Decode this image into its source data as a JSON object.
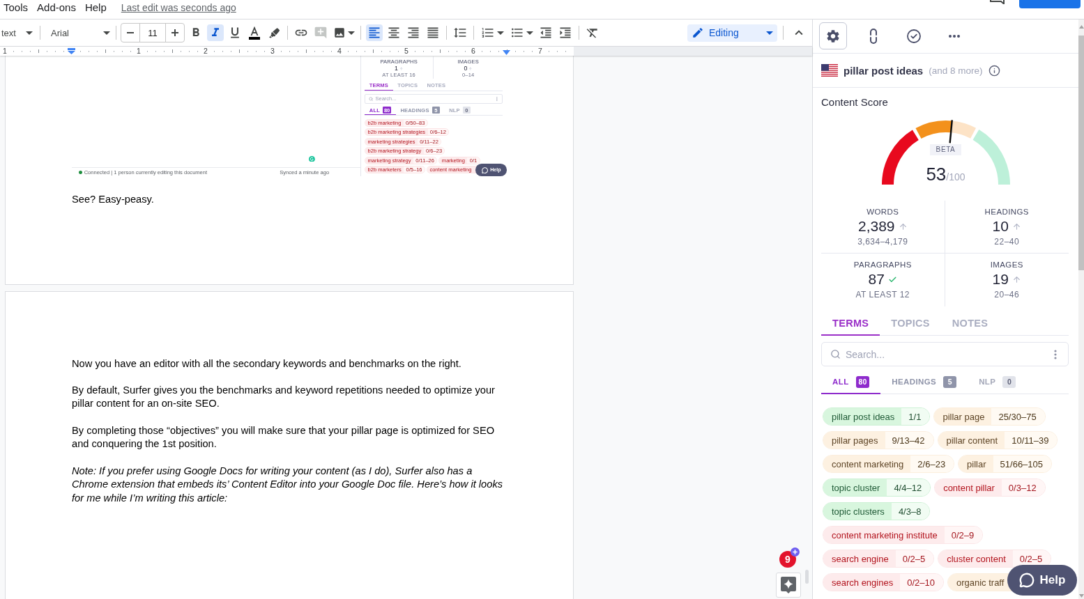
{
  "menu_bar": {
    "items": [
      "Tools",
      "Add-ons",
      "Help"
    ],
    "last_edit": "Last edit was seconds ago"
  },
  "toolbar": {
    "style": "text",
    "font": "Arial",
    "font_size": "11",
    "format": [
      {
        "kind": "bold",
        "selected": false
      },
      {
        "kind": "italic",
        "selected": true
      },
      {
        "kind": "underline",
        "selected": false
      }
    ],
    "insert": [
      {
        "kind": "link",
        "disabled": false
      },
      {
        "kind": "comment",
        "disabled": true
      },
      {
        "kind": "image",
        "disabled": false
      }
    ],
    "align": [
      {
        "kind": "left",
        "selected": true
      },
      {
        "kind": "center",
        "selected": false
      },
      {
        "kind": "right",
        "selected": false
      },
      {
        "kind": "justify",
        "selected": false
      }
    ],
    "mode": "Editing"
  },
  "ruler": {
    "labels": [
      "1",
      "1",
      "2",
      "3",
      "4",
      "5",
      "6",
      "7"
    ]
  },
  "document": {
    "pages": [
      {
        "blocks": [
          {
            "kind": "screenshot"
          },
          {
            "kind": "paragraph",
            "text": "See? Easy-peasy.",
            "italic": false
          }
        ]
      },
      {
        "blocks": [
          {
            "kind": "paragraph",
            "text": "Now you have an editor with all the secondary keywords and benchmarks on the right.",
            "italic": false
          },
          {
            "kind": "paragraph",
            "text": "By default, Surfer gives you the benchmarks and keyword repetitions needed to optimize your pillar content for an on-site SEO.",
            "italic": false
          },
          {
            "kind": "paragraph",
            "text": "By completing those “objectives” you will make sure that your pillar page is optimized for SEO and conquering the 1st position.",
            "italic": false
          },
          {
            "kind": "paragraph",
            "text": "Note: If you prefer using Google Docs for writing your content (as I do), Surfer also has a Chrome extension that embeds its’ Content Editor into your Google Doc file. Here’s how it looks for me while I’m writing this article:",
            "italic": true
          }
        ]
      }
    ]
  },
  "screenshot": {
    "footer": {
      "status": "Connected | 1 person currently editing this document",
      "sync": "Synced a minute ago"
    },
    "metrics": [
      {
        "label": "PARAGRAPHS",
        "value": "1",
        "range": "AT LEAST 16",
        "kind": "below"
      },
      {
        "label": "IMAGES",
        "value": "0",
        "range": "0–14",
        "kind": "below"
      }
    ],
    "tabs": [
      {
        "label": "TERMS",
        "selected": true
      },
      {
        "label": "TOPICS",
        "selected": false
      },
      {
        "label": "NOTES",
        "selected": false
      }
    ],
    "search": {
      "placeholder": "Search..."
    },
    "filters": [
      {
        "label": "ALL",
        "count": "80",
        "selected": true,
        "disabled": false
      },
      {
        "label": "HEADINGS",
        "count": "5",
        "selected": false,
        "disabled": false
      },
      {
        "label": "NLP",
        "count": "0",
        "selected": false,
        "disabled": true
      }
    ],
    "term_rows": [
      [
        {
          "term": "b2b marketing",
          "count": "0/50–83",
          "kind": "missing"
        }
      ],
      [
        {
          "term": "b2b marketing strategies",
          "count": "0/6–12",
          "kind": "missing"
        }
      ],
      [
        {
          "term": "marketing strategies",
          "count": "0/11–22",
          "kind": "missing"
        }
      ],
      [
        {
          "term": "b2b marketing strategy",
          "count": "0/6–23",
          "kind": "missing"
        }
      ],
      [
        {
          "term": "marketing strategy",
          "count": "0/11–26",
          "kind": "missing"
        },
        {
          "term": "marketing",
          "count": "0/1",
          "kind": "missing"
        }
      ],
      [
        {
          "term": "b2b marketers",
          "count": "0/5–16",
          "kind": "missing"
        },
        {
          "term": "content marketing",
          "kind": "missing"
        }
      ]
    ],
    "help": "Help"
  },
  "side_panel": {
    "tools": [
      {
        "kind": "settings",
        "selected": true
      },
      {
        "kind": "link",
        "selected": false
      },
      {
        "kind": "review",
        "selected": false
      },
      {
        "kind": "more",
        "selected": false
      }
    ],
    "keyword": "pillar post ideas",
    "more_keywords": "(and 8 more)",
    "score": {
      "title": "Content Score",
      "badge": "BETA",
      "value": "53",
      "max": "/100",
      "level": 0.53
    },
    "metrics": [
      {
        "label": "WORDS",
        "value": "2,389",
        "range": "3,634–4,179",
        "kind": "below"
      },
      {
        "label": "HEADINGS",
        "value": "10",
        "range": "22–40",
        "kind": "below"
      },
      {
        "label": "PARAGRAPHS",
        "value": "87",
        "range": "AT LEAST 12",
        "kind": "met"
      },
      {
        "label": "IMAGES",
        "value": "19",
        "range": "20–46",
        "kind": "below"
      }
    ],
    "tabs": [
      {
        "label": "TERMS",
        "selected": true
      },
      {
        "label": "TOPICS",
        "selected": false
      },
      {
        "label": "NOTES",
        "selected": false
      }
    ],
    "search": {
      "placeholder": "Search..."
    },
    "filters": [
      {
        "label": "ALL",
        "count": "80",
        "selected": true,
        "disabled": false
      },
      {
        "label": "HEADINGS",
        "count": "5",
        "selected": false,
        "disabled": false
      },
      {
        "label": "NLP",
        "count": "0",
        "selected": false,
        "disabled": true
      }
    ],
    "terms": [
      {
        "term": "pillar post ideas",
        "count": "1/1",
        "kind": "met"
      },
      {
        "term": "pillar page",
        "count": "25/30–75",
        "kind": "under"
      },
      {
        "term": "pillar pages",
        "count": "9/13–42",
        "kind": "under"
      },
      {
        "term": "pillar content",
        "count": "10/11–39",
        "kind": "under"
      },
      {
        "term": "content marketing",
        "count": "2/6–23",
        "kind": "under"
      },
      {
        "term": "pillar",
        "count": "51/66–105",
        "kind": "under"
      },
      {
        "term": "topic cluster",
        "count": "4/4–12",
        "kind": "met"
      },
      {
        "term": "content pillar",
        "count": "0/3–12",
        "kind": "missing"
      },
      {
        "term": "topic clusters",
        "count": "4/3–8",
        "kind": "met"
      },
      {
        "term": "content marketing institute",
        "count": "0/2–9",
        "kind": "missing"
      },
      {
        "term": "search engine",
        "count": "0/2–5",
        "kind": "missing"
      },
      {
        "term": "cluster content",
        "count": "0/2–5",
        "kind": "missing"
      },
      {
        "term": "search engines",
        "count": "0/2–10",
        "kind": "missing"
      },
      {
        "term": "organic traff",
        "kind": "under"
      }
    ],
    "help": "Help"
  },
  "notifications": {
    "count": "9"
  }
}
